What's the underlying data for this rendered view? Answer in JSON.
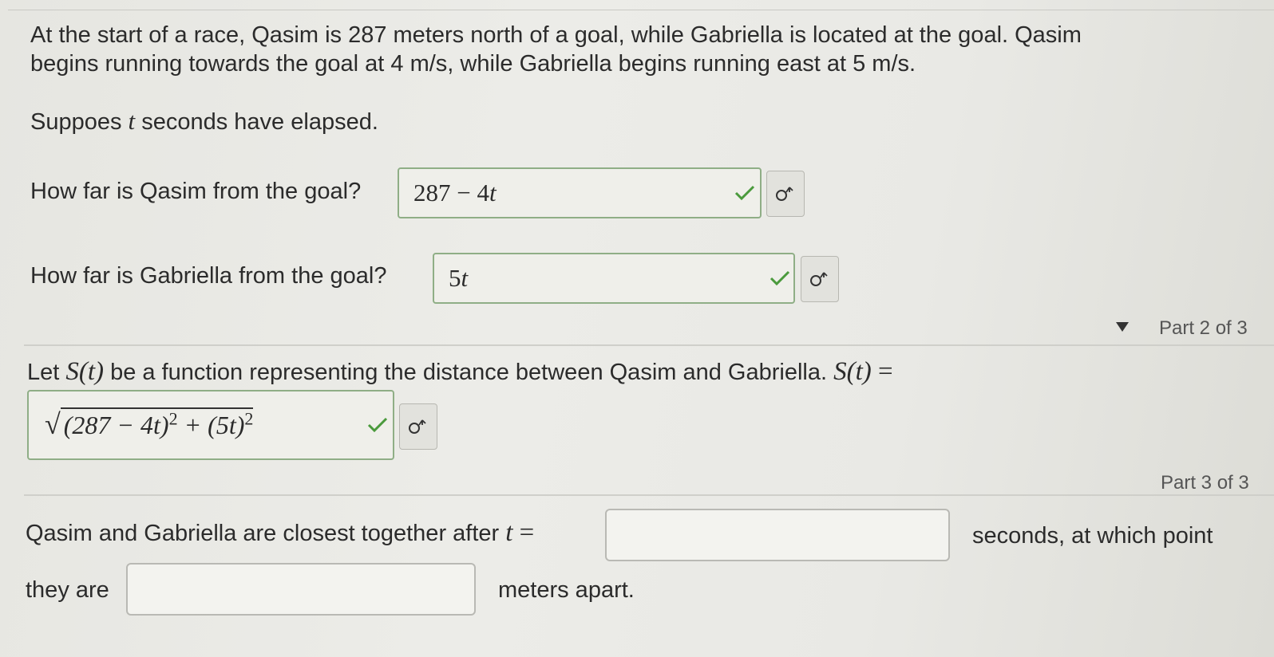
{
  "problem": {
    "line1": "At the start of a race, Qasim is 287 meters north of a goal, while Gabriella is located at the goal. Qasim",
    "line2": "begins running towards the goal at 4 m/s, while Gabriella begins running east at 5 m/s.",
    "suppose_pre": "Suppoes ",
    "suppose_var": "t",
    "suppose_post": " seconds have elapsed."
  },
  "part1": {
    "q1_label": "How far is Qasim from the goal?",
    "q1_answer_num": "287 − 4",
    "q1_answer_var": "t",
    "q2_label": "How far is Gabriella from the goal?",
    "q2_answer_num": "5",
    "q2_answer_var": "t"
  },
  "part2": {
    "header": "Part 2 of 3",
    "prompt_pre": "Let ",
    "prompt_func": "S(t)",
    "prompt_mid": " be a function representing the distance between Qasim and Gabriella. ",
    "prompt_func2": "S(t)",
    "prompt_eq": " =",
    "answer_inside": "(287 − 4t)",
    "answer_exp1": "2",
    "answer_plus": " + (5t)",
    "answer_exp2": "2"
  },
  "part3": {
    "header": "Part 3 of 3",
    "line1_pre": "Qasim and Gabriella are closest together after ",
    "line1_var": "t",
    "line1_eq": " =",
    "line1_post": "seconds, at which point",
    "line2_pre": "they are",
    "line2_post": "meters apart.",
    "input_t_value": "",
    "input_dist_value": ""
  },
  "colors": {
    "check": "#4a9a3c",
    "correct_border": "#8fae86",
    "text": "#2b2b2b"
  },
  "icons": {
    "check": "checkmark-icon",
    "symbol": "sigma-symbol-icon",
    "collapse": "triangle-down-icon"
  }
}
